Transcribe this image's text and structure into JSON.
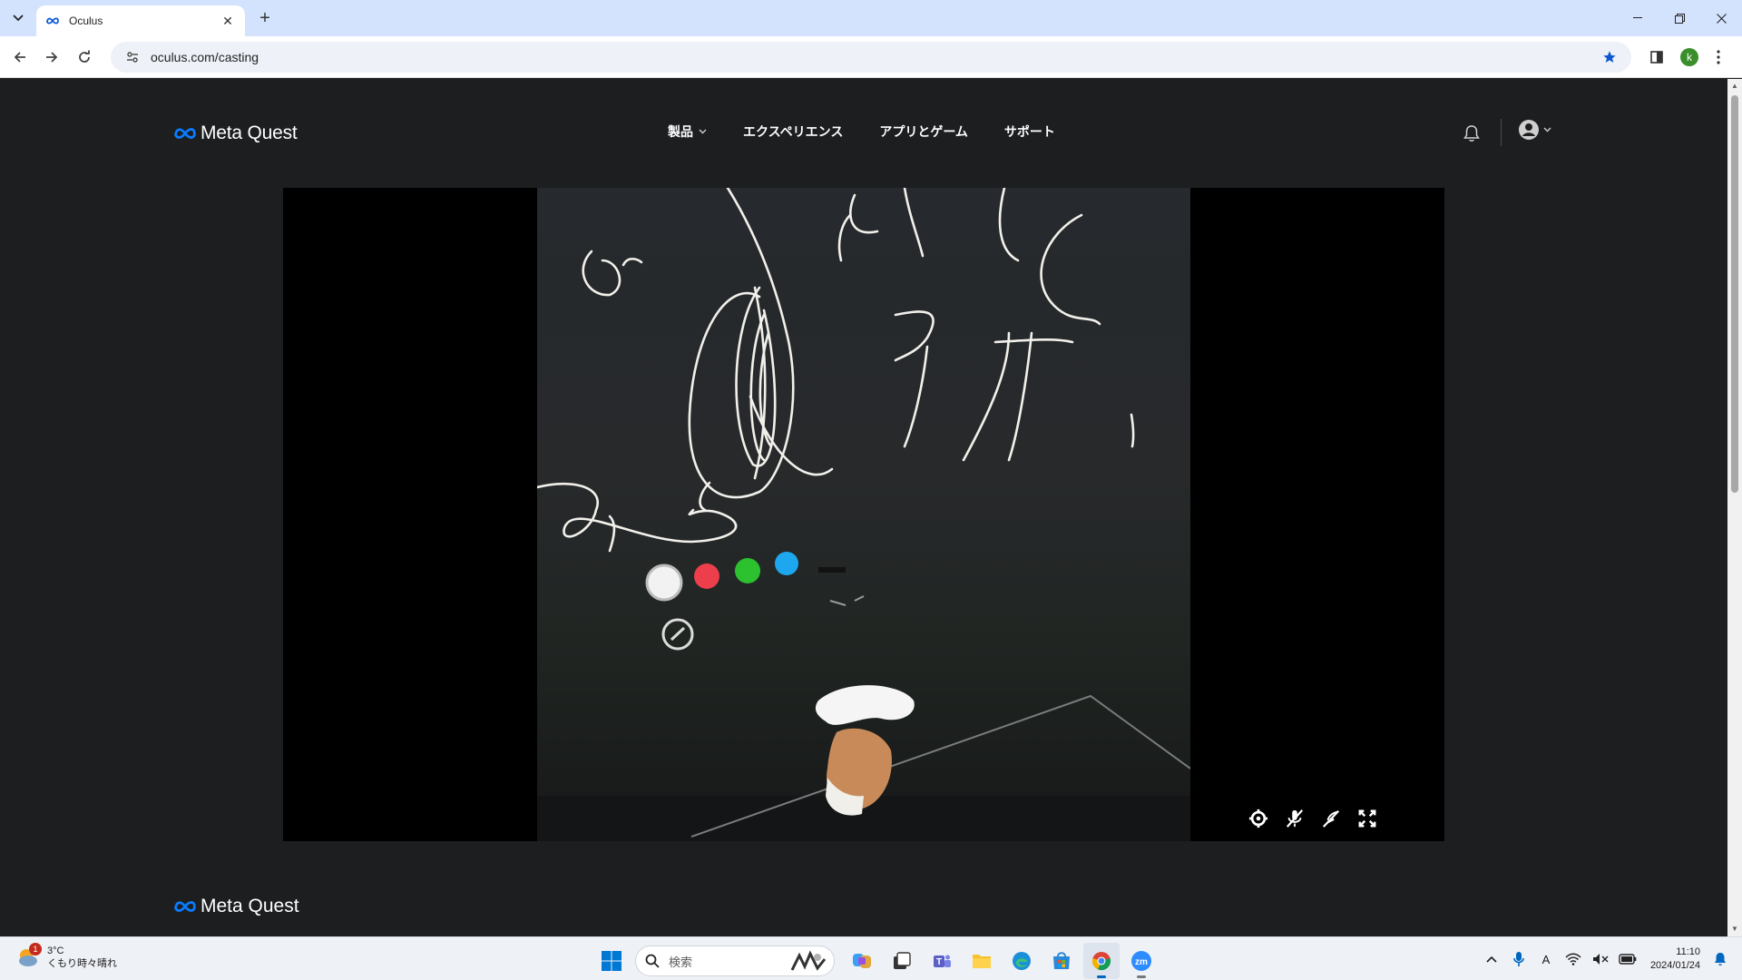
{
  "browser": {
    "tab_title": "Oculus",
    "url": "oculus.com/casting",
    "profile_initial": "k",
    "new_tab_label": "+",
    "close_tab_label": "✕"
  },
  "site": {
    "logo_text": "Meta Quest",
    "nav": [
      {
        "label": "製品",
        "has_dropdown": true
      },
      {
        "label": "エクスペリエンス"
      },
      {
        "label": "アプリとゲーム"
      },
      {
        "label": "サポート"
      }
    ],
    "footer_logo_text": "Meta Quest"
  },
  "player": {
    "controls": [
      "settings-icon",
      "mic-off-icon",
      "audio-off-icon",
      "fullscreen-icon"
    ]
  },
  "taskbar": {
    "weather_temp": "3°C",
    "weather_desc": "くもり時々晴れ",
    "weather_badge": "1",
    "search_placeholder": "検索",
    "time": "11:10",
    "date": "2024/01/24",
    "ime_label": "A"
  },
  "colors": {
    "page_bg": "#1c1e20",
    "video_bg": "#000000",
    "tabstrip_bg": "#d3e3fd",
    "accent": "#0a5cd6"
  }
}
